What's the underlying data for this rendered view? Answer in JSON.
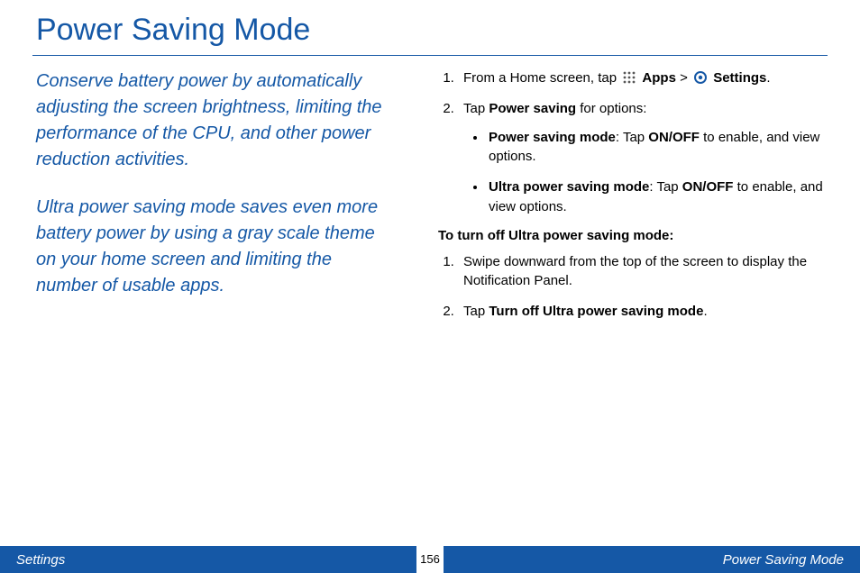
{
  "title": "Power Saving Mode",
  "intro": {
    "p1": "Conserve battery power by automatically adjusting the screen brightness, limiting the performance of the CPU, and other power reduction activities.",
    "p2": "Ultra power saving mode saves even more battery power by using a gray scale theme on your home screen and limiting the number of usable apps."
  },
  "steps": {
    "s1": {
      "pre": "From a Home screen, tap ",
      "apps_label": "Apps",
      "gt": " > ",
      "settings_label": "Settings",
      "post": "."
    },
    "s2": {
      "pre": "Tap ",
      "bold": "Power saving",
      "post": " for options:"
    },
    "bullets": {
      "b1": {
        "bold": "Power saving mode",
        "mid": ": Tap ",
        "bold2": "ON/OFF",
        "post": " to enable, and view options."
      },
      "b2": {
        "bold": "Ultra power saving mode",
        "mid": ": Tap ",
        "bold2": "ON/OFF",
        "post": " to enable, and view options."
      }
    }
  },
  "subhead": "To turn off Ultra power saving mode:",
  "steps2": {
    "s1": "Swipe downward from the top of the screen to display the Notification Panel.",
    "s2": {
      "pre": "Tap ",
      "bold": "Turn off Ultra power saving mode",
      "post": "."
    }
  },
  "footer": {
    "left": "Settings",
    "page": "156",
    "right": "Power Saving Mode"
  },
  "icons": {
    "apps": "apps-grid-icon",
    "settings": "settings-gear-icon"
  }
}
